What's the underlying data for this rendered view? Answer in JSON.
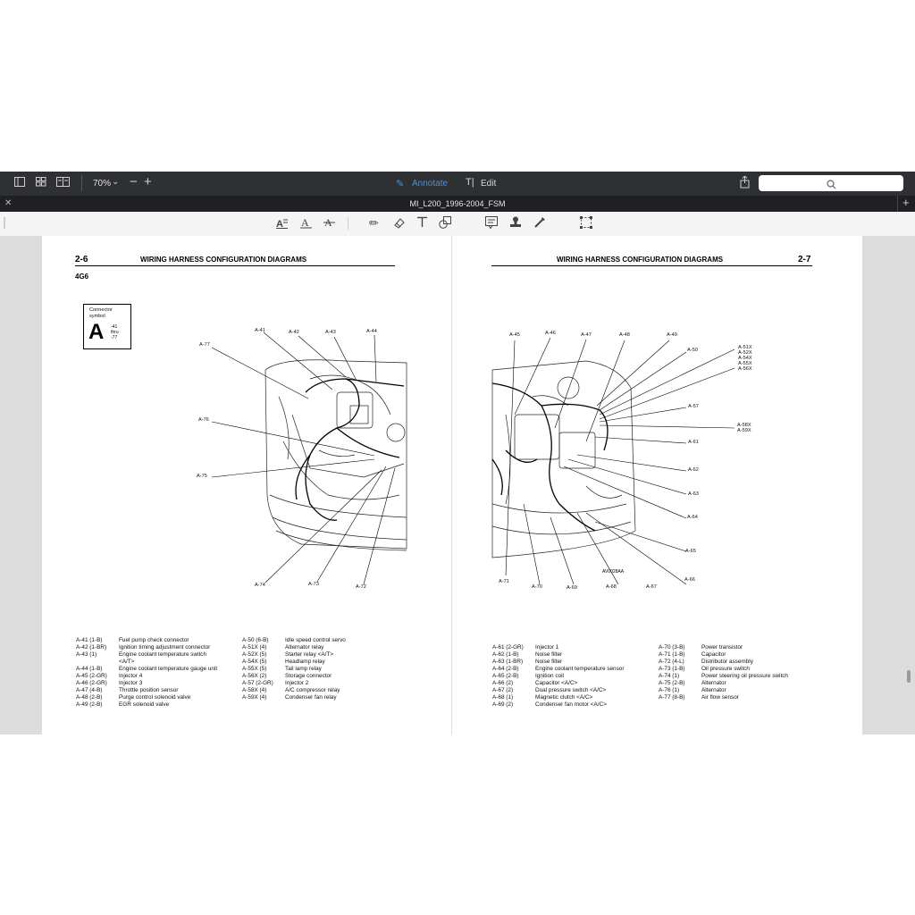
{
  "toolbar": {
    "zoom": "70%",
    "annotate_label": "Annotate",
    "edit_label": "Edit",
    "search_placeholder": ""
  },
  "tab": {
    "title": "MI_L200_1996-2004_FSM"
  },
  "colors": {
    "toolbar_bg": "#2f3034",
    "tab_bg": "#1f2023",
    "accent": "#4a8fd6"
  },
  "icons": {
    "top": [
      "sidebar-icon",
      "grid-icon",
      "contact-sheet-icon",
      "chevron-down-icon",
      "zoom-out-icon",
      "zoom-in-icon",
      "pen-icon",
      "text-cursor-icon",
      "share-icon",
      "search-icon"
    ],
    "annotation": [
      "text-box-icon",
      "text-style-icon",
      "strikethrough-icon",
      "pencil-icon",
      "eraser-icon",
      "text-icon",
      "shapes-icon",
      "note-icon",
      "stamp-icon",
      "signature-icon",
      "selection-icon"
    ]
  },
  "left_page": {
    "page_num": "2-6",
    "title": "WIRING HARNESS CONFIGURATION DIAGRAMS",
    "engine": "4G6",
    "connector_box": {
      "label1": "Connector",
      "label2": "symbol",
      "letter": "A",
      "range1": "-41",
      "range2": "thru",
      "range3": "-77"
    },
    "callouts": [
      "A-41",
      "A-42",
      "A-43",
      "A-44",
      "A-77",
      "A-76",
      "A-75",
      "A-74",
      "A-73",
      "A-72"
    ],
    "legend_col1": [
      [
        "A-41 (1-B)",
        "Fuel pump check connector"
      ],
      [
        "A-42 (1-BR)",
        "Ignition timing adjustment connector"
      ],
      [
        "A-43 (1)",
        "Engine    coolant    temperature    switch"
      ],
      [
        "",
        "<A/T>"
      ],
      [
        "A-44 (1-B)",
        "Engine coolant temperature gauge unit"
      ],
      [
        "A-45 (2-GR)",
        "Injector 4"
      ],
      [
        "A-46 (2-GR)",
        "Injector 3"
      ],
      [
        "A-47 (4-B)",
        "Throttle position sensor"
      ],
      [
        "A-48 (2-B)",
        "Purge control solenoid valve"
      ],
      [
        "A-49 (2-B)",
        "EGR solenoid valve"
      ]
    ],
    "legend_col2": [
      [
        "A-50 (6-B)",
        "Idle speed control servo"
      ],
      [
        "A-51X (4)",
        "Alternator relay"
      ],
      [
        "A-52X (5)",
        "Starter relay <A/T>"
      ],
      [
        "A-54X (5)",
        "Headlamp relay"
      ],
      [
        "A-55X (5)",
        "Tail lamp relay"
      ],
      [
        "A-56X (2)",
        "Storage connector"
      ],
      [
        "A-57 (2-GR)",
        "Injector 2"
      ],
      [
        "A-58X (4)",
        "A/C compressor relay"
      ],
      [
        "A-59X (4)",
        "Condenser fan relay"
      ]
    ]
  },
  "right_page": {
    "page_num": "2-7",
    "title": "WIRING HARNESS CONFIGURATION DIAGRAMS",
    "figure_code": "AV0028AA",
    "callouts": [
      "A-45",
      "A-46",
      "A-47",
      "A-48",
      "A-49",
      "A-50",
      "A-51X",
      "A-52X",
      "A-54X",
      "A-55X",
      "A-56X",
      "A-57",
      "A-58X",
      "A-59X",
      "A-61",
      "A-62",
      "A-63",
      "A-64",
      "A-65",
      "A-66",
      "A-67",
      "A-68",
      "A-69",
      "A-70",
      "A-71"
    ],
    "legend_col1": [
      [
        "A-61 (2-GR)",
        "Injector 1"
      ],
      [
        "A-62 (1-B)",
        "Noise filter"
      ],
      [
        "A-63 (1-BR)",
        "Noise filter"
      ],
      [
        "A-64 (2-B)",
        "Engine coolant temperature sensor"
      ],
      [
        "A-65 (2-B)",
        "Ignition coil"
      ],
      [
        "A-66 (2)",
        "Capacitor <A/C>"
      ],
      [
        "A-67 (2)",
        "Dual pressure switch <A/C>"
      ],
      [
        "A-68 (1)",
        "Magnetic clutch <A/C>"
      ],
      [
        "A-69 (2)",
        "Condenser fan motor <A/C>"
      ]
    ],
    "legend_col2": [
      [
        "A-70 (3-B)",
        "Power transistor"
      ],
      [
        "A-71 (1-B)",
        "Capacitor"
      ],
      [
        "A-72 (4-L)",
        "Distributor assembly"
      ],
      [
        "A-73 (1-B)",
        "Oil pressure switch"
      ],
      [
        "A-74 (1)",
        "Power steering oil pressure switch"
      ],
      [
        "A-75 (2-B)",
        "Alternator"
      ],
      [
        "A-76 (1)",
        "Alternator"
      ],
      [
        "A-77 (8-B)",
        "Air flow sensor"
      ]
    ]
  }
}
